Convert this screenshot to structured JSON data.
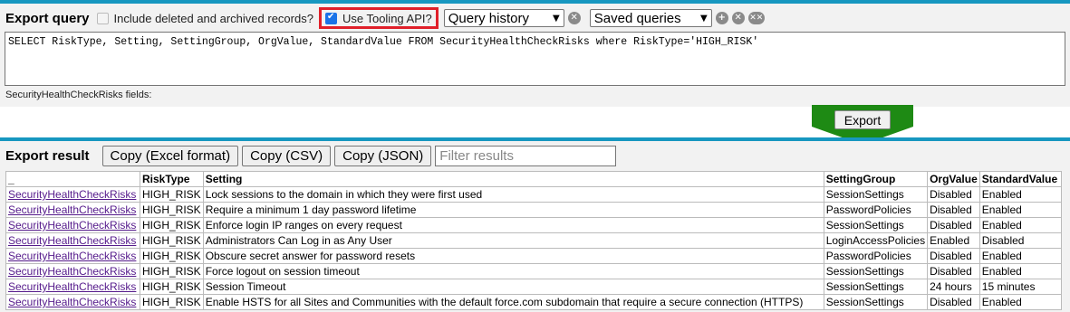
{
  "query": {
    "title": "Export query",
    "include_deleted_label": "Include deleted and archived records?",
    "tooling_label": "Use Tooling API?",
    "history_select": "Query history",
    "saved_select": "Saved queries",
    "soql": "SELECT RiskType, Setting, SettingGroup, OrgValue, StandardValue FROM SecurityHealthCheckRisks where RiskType='HIGH_RISK'",
    "fields_label": "SecurityHealthCheckRisks fields:"
  },
  "export_button": "Export",
  "result": {
    "title": "Export result",
    "copy_excel": "Copy (Excel format)",
    "copy_csv": "Copy (CSV)",
    "copy_json": "Copy (JSON)",
    "filter_placeholder": "Filter results",
    "columns": [
      "_",
      "RiskType",
      "Setting",
      "SettingGroup",
      "OrgValue",
      "StandardValue"
    ],
    "rows": [
      [
        "SecurityHealthCheckRisks",
        "HIGH_RISK",
        "Lock sessions to the domain in which they were first used",
        "SessionSettings",
        "Disabled",
        "Enabled"
      ],
      [
        "SecurityHealthCheckRisks",
        "HIGH_RISK",
        "Require a minimum 1 day password lifetime",
        "PasswordPolicies",
        "Disabled",
        "Enabled"
      ],
      [
        "SecurityHealthCheckRisks",
        "HIGH_RISK",
        "Enforce login IP ranges on every request",
        "SessionSettings",
        "Disabled",
        "Enabled"
      ],
      [
        "SecurityHealthCheckRisks",
        "HIGH_RISK",
        "Administrators Can Log in as Any User",
        "LoginAccessPolicies",
        "Enabled",
        "Disabled"
      ],
      [
        "SecurityHealthCheckRisks",
        "HIGH_RISK",
        "Obscure secret answer for password resets",
        "PasswordPolicies",
        "Disabled",
        "Enabled"
      ],
      [
        "SecurityHealthCheckRisks",
        "HIGH_RISK",
        "Force logout on session timeout",
        "SessionSettings",
        "Disabled",
        "Enabled"
      ],
      [
        "SecurityHealthCheckRisks",
        "HIGH_RISK",
        "Session Timeout",
        "SessionSettings",
        "24 hours",
        "15 minutes"
      ],
      [
        "SecurityHealthCheckRisks",
        "HIGH_RISK",
        "Enable HSTS for all Sites and Communities with the default force.com subdomain that require a secure connection (HTTPS)",
        "SessionSettings",
        "Disabled",
        "Enabled"
      ]
    ]
  },
  "colors": {
    "accent": "#1797c0",
    "highlight_box": "#e0202a",
    "arrow": "#1e8a14"
  },
  "icons": [
    "clear-history-icon",
    "add-query-icon",
    "remove-query-icon",
    "clear-all-queries-icon"
  ]
}
